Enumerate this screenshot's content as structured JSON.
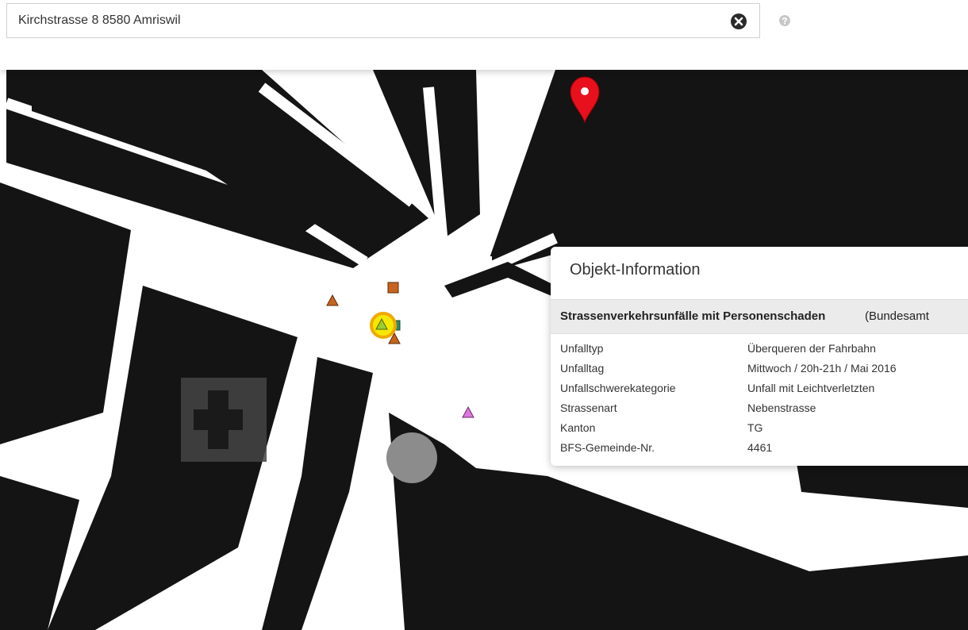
{
  "search": {
    "value": "Kirchstrasse 8 8580 Amriswil",
    "clear_icon": "times-circle-icon",
    "help_icon": "question-circle-icon"
  },
  "map": {
    "marker_icon": "map-pin-icon",
    "colors": {
      "building": "#141414",
      "street": "#ffffff",
      "marker": "#e8101c",
      "accident_light": "#c8641e",
      "accident_pedestrian": "#dd77dd",
      "highlight": "#f0a800",
      "highlight_fill": "#f5e800",
      "highlight_square": "#2e8b6e"
    }
  },
  "popup": {
    "title": "Objekt-Information",
    "layer_name": "Strassenverkehrsunfälle mit Personenschaden",
    "layer_source": "(Bundesamt",
    "attributes": [
      {
        "key": "Unfalltyp",
        "value": "Überqueren der Fahrbahn"
      },
      {
        "key": "Unfalltag",
        "value": "Mittwoch / 20h-21h / Mai 2016"
      },
      {
        "key": "Unfallschwerekategorie",
        "value": "Unfall mit Leichtverletzten"
      },
      {
        "key": "Strassenart",
        "value": "Nebenstrasse"
      },
      {
        "key": "Kanton",
        "value": "TG"
      },
      {
        "key": "BFS-Gemeinde-Nr.",
        "value": "4461"
      }
    ]
  }
}
